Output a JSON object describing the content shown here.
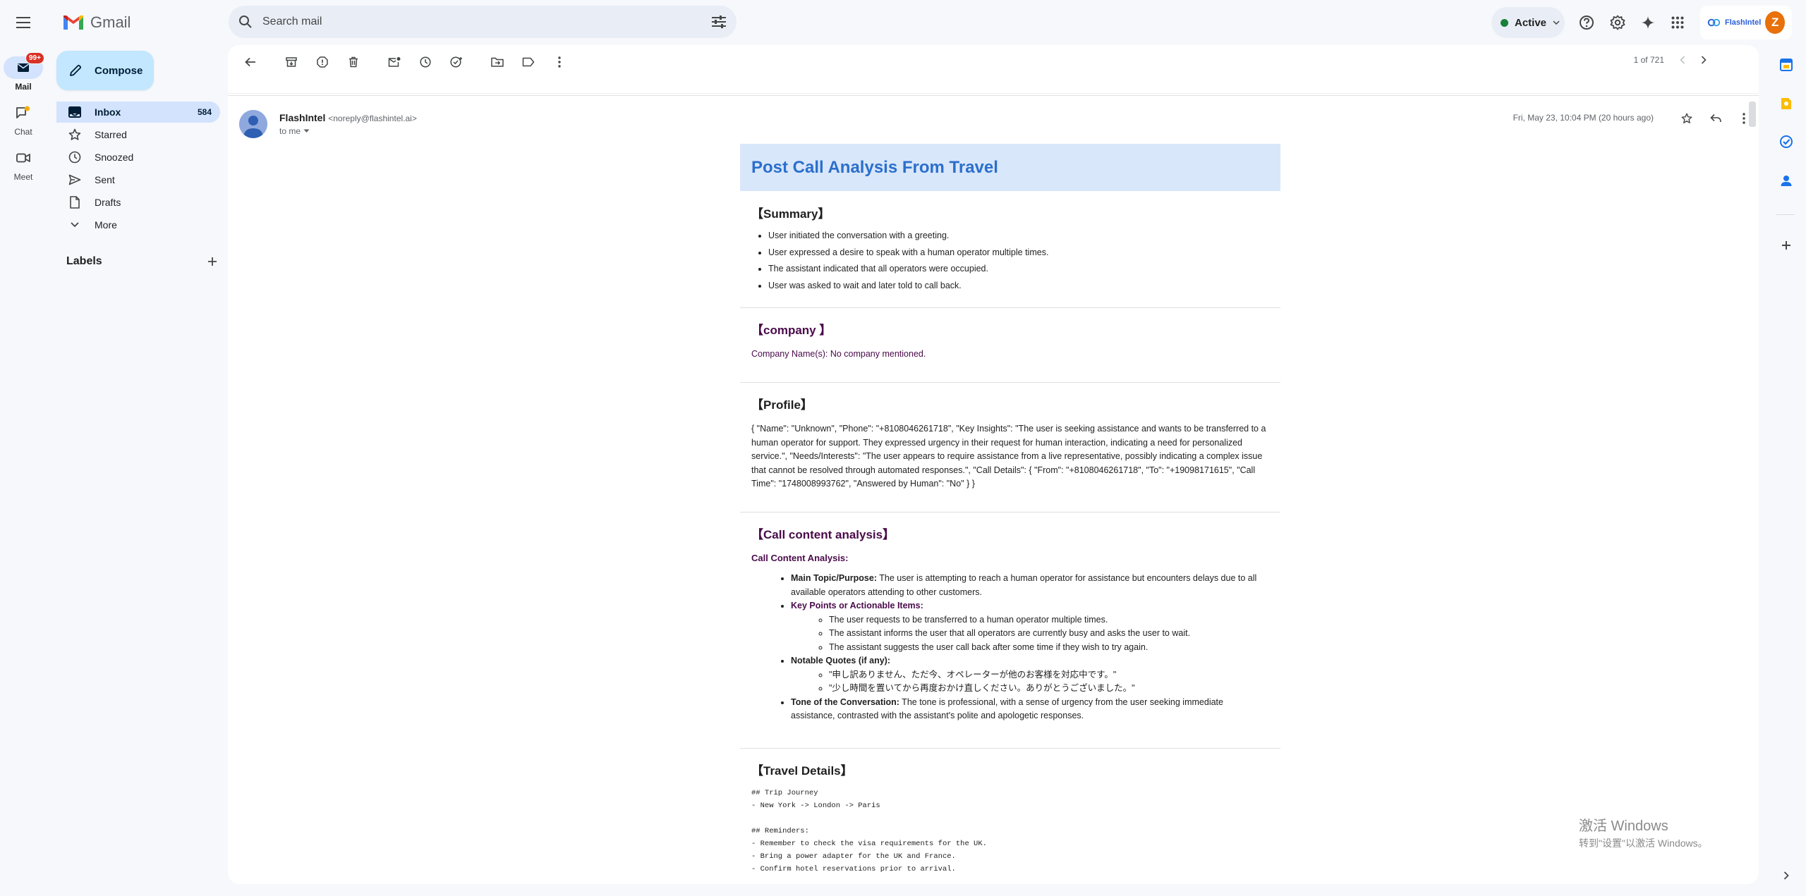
{
  "app": {
    "brand": "Gmail",
    "search_placeholder": "Search mail",
    "status": "Active",
    "org_label": "FlashIntel",
    "avatar_letter": "Z"
  },
  "rail": {
    "mail_label": "Mail",
    "mail_badge": "99+",
    "chat_label": "Chat",
    "meet_label": "Meet"
  },
  "nav": {
    "compose": "Compose",
    "items": [
      {
        "label": "Inbox",
        "count": "584"
      },
      {
        "label": "Starred"
      },
      {
        "label": "Snoozed"
      },
      {
        "label": "Sent"
      },
      {
        "label": "Drafts"
      },
      {
        "label": "More"
      }
    ],
    "labels_heading": "Labels"
  },
  "toolbar": {
    "pager_text": "1 of 721"
  },
  "message": {
    "sender_name": "FlashIntel",
    "sender_email": "<noreply@flashintel.ai>",
    "to_text": "to me",
    "date": "Fri, May 23, 10:04 PM (20 hours ago)"
  },
  "email": {
    "title": "Post Call Analysis From Travel",
    "summary_title": "【Summary】",
    "summary_items": [
      "User initiated the conversation with a greeting.",
      "User expressed a desire to speak with a human operator multiple times.",
      "The assistant indicated that all operators were occupied.",
      "User was asked to wait and later told to call back."
    ],
    "company_title": "【company 】",
    "company_text": "Company Name(s): No company mentioned.",
    "profile_title": "【Profile】",
    "profile_text": "{ \"Name\": \"Unknown\", \"Phone\": \"+8108046261718\", \"Key Insights\": \"The user is seeking assistance and wants to be transferred to a human operator for support. They expressed urgency in their request for human interaction, indicating a need for personalized service.\", \"Needs/Interests\": \"The user appears to require assistance from a live representative, possibly indicating a complex issue that cannot be resolved through automated responses.\", \"Call Details\": { \"From\": \"+8108046261718\", \"To\": \"+19098171615\", \"Call Time\": \"1748008993762\", \"Answered by Human\": \"No\" } }",
    "cca_title": "【Call content analysis】",
    "cca_label": "Call Content Analysis:",
    "main_topic_label": "Main Topic/Purpose:",
    "main_topic_text": " The user is attempting to reach a human operator for assistance but encounters delays due to all available operators attending to other customers.",
    "key_points_label": "Key Points or Actionable Items:",
    "key_points": [
      "The user requests to be transferred to a human operator multiple times.",
      "The assistant informs the user that all operators are currently busy and asks the user to wait.",
      "The assistant suggests the user call back after some time if they wish to try again."
    ],
    "quotes_label": "Notable Quotes (if any):",
    "quotes": [
      "\"申し訳ありません、ただ今、オペレーターが他のお客様を対応中です。\"",
      "\"少し時間を置いてから再度おかけ直しください。ありがとうございました。\""
    ],
    "tone_label": "Tone of the Conversation:",
    "tone_text": " The tone is professional, with a sense of urgency from the user seeking immediate assistance, contrasted with the assistant's polite and apologetic responses.",
    "travel_title": "【Travel Details】",
    "travel_lines": [
      "## Trip Journey",
      "- New York -> London -> Paris",
      "",
      "## Reminders:",
      "- Remember to check the visa requirements for the UK.",
      "- Bring a power adapter for the UK and France.",
      "- Confirm hotel reservations prior to arrival."
    ]
  },
  "watermark": {
    "line1": "激活 Windows",
    "line2": "转到\"设置\"以激活 Windows。"
  },
  "colors": {
    "accent_blue": "#2b6fcb",
    "compose_bg": "#c2e7ff",
    "nav_active_bg": "#d3e3fd",
    "status_green": "#188038",
    "badge_red": "#d93025",
    "section_purple": "#4a0b4a"
  }
}
